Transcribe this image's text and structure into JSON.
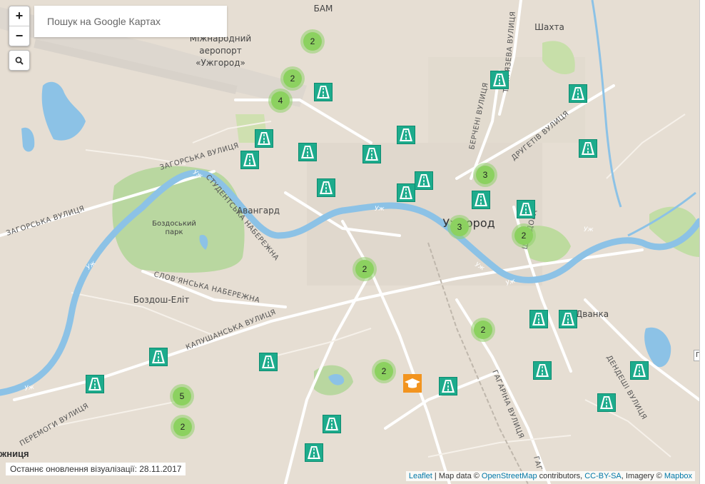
{
  "search": {
    "placeholder": "Пошук на Google Картах"
  },
  "zoom": {
    "in_label": "+",
    "out_label": "−"
  },
  "footer": {
    "update_note": "Останнє оновлення візуалізації: 28.11.2017",
    "attribution": {
      "leaflet": "Leaflet",
      "sep1": " | Map data © ",
      "osm": "OpenStreetMap",
      "contrib": " contributors, ",
      "license": "CC-BY-SA",
      "imagery": ", Imagery © ",
      "mapbox": "Mapbox"
    }
  },
  "edge_text": "жниця",
  "map_labels": {
    "bam": "БАМ",
    "airport_1": "Міжнародний",
    "airport_2": "аеропорт",
    "airport_3": "«Ужгород»",
    "shakhta": "Шахта",
    "uzhhorod": "Ужгород",
    "avanhard": "Авангард",
    "park_1": "Боздоський",
    "park_2": "парк",
    "bozdosh": "Боздош-Еліт",
    "dvanka": "Дванка",
    "zahorska_1": "ЗАГОРСЬКА ВУЛИЦЯ",
    "zahorska_2": "ЗАГОРСЬКА ВУЛИЦЯ",
    "studentska": "СТУДЕНТСЬКА НАБЕРЕЖНА",
    "slovianska": "СЛОВ'ЯНСЬКА НАБЕРЕЖНА",
    "kapushanska": "КАПУШАНСЬКА ВУЛИЦЯ",
    "peremohy": "ПЕРЕМОГИ ВУЛИЦЯ",
    "hagarina": "ГАГАРІНА ВУЛИЦЯ",
    "hagarina_2": "ГАГ",
    "bercheni": "БЕРЧЕНІ ВУЛИЦЯ",
    "druhetiv": "ДРУГЕТІВ ВУЛИЦЯ",
    "timiriazeva": "ТІМІРЯЗЕВА ВУЛИЦЯ",
    "dendeshi": "ДЕНДЕШІ ВУЛИЦЯ",
    "shandora": "ШАНДОРА",
    "uzh_1": "Уж",
    "uzh_2": "Уж",
    "uzh_3": "Уж",
    "uzh_4": "Уж",
    "uzh_5": "Уж",
    "uzh_6": "Уж",
    "uzh_7": "Уж"
  },
  "clusters": [
    {
      "count": "2"
    },
    {
      "count": "2"
    },
    {
      "count": "4"
    },
    {
      "count": "3"
    },
    {
      "count": "3"
    },
    {
      "count": "2"
    },
    {
      "count": "2"
    },
    {
      "count": "2"
    },
    {
      "count": "2"
    },
    {
      "count": "5"
    },
    {
      "count": "2"
    }
  ],
  "road_marker_count": 26,
  "icons": {
    "road": "road-icon",
    "education": "graduation-cap-icon",
    "search": "search-icon"
  },
  "colors": {
    "road_marker": "#1dab8c",
    "edu_marker": "#f2941f",
    "cluster": "#8cd160",
    "river": "#8cc2e6",
    "park": "#b9d7a0"
  }
}
